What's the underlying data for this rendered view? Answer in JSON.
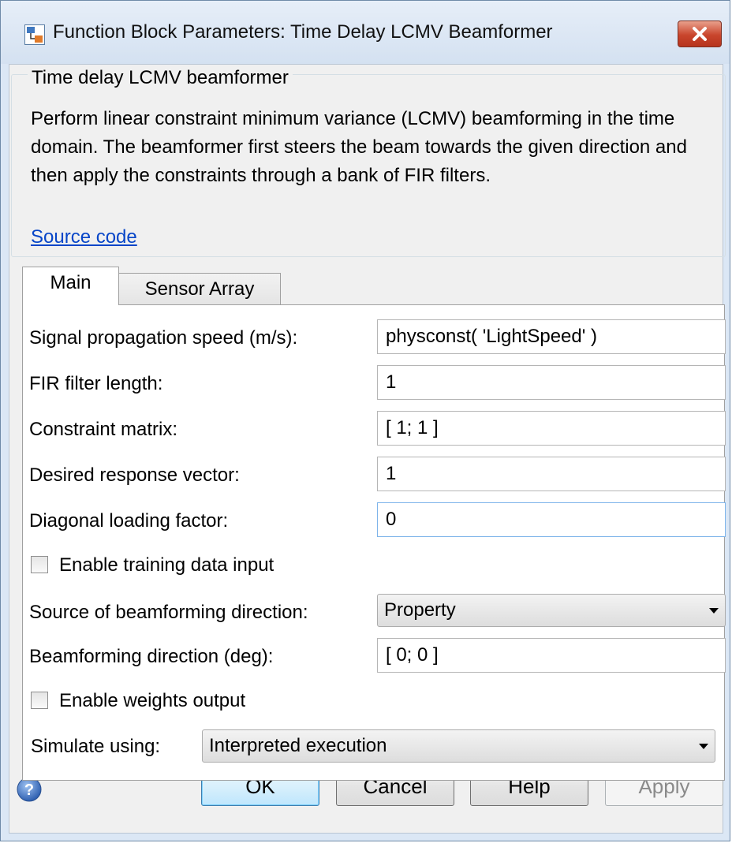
{
  "window": {
    "title": "Function Block Parameters: Time Delay LCMV Beamformer"
  },
  "description": {
    "group_title": "Time delay LCMV beamformer",
    "text": "Perform linear constraint minimum variance (LCMV) beamforming in the time domain. The beamformer first steers the beam towards the given direction and then apply the constraints through a bank of FIR filters.",
    "source_link": "Source code"
  },
  "tabs": [
    {
      "label": "Main",
      "selected": true
    },
    {
      "label": "Sensor Array",
      "selected": false
    }
  ],
  "params": {
    "propagation_speed": {
      "label": "Signal propagation speed (m/s):",
      "value": "physconst( 'LightSpeed' )"
    },
    "fir_length": {
      "label": "FIR filter length:",
      "value": "1"
    },
    "constraint_matrix": {
      "label": "Constraint matrix:",
      "value": "[ 1; 1 ]"
    },
    "desired_response": {
      "label": "Desired response vector:",
      "value": "1"
    },
    "diagonal_loading": {
      "label": "Diagonal loading factor:",
      "value": "0"
    },
    "training_input": {
      "label": "Enable training data input",
      "checked": false
    },
    "direction_source": {
      "label": "Source of beamforming direction:",
      "value": "Property"
    },
    "direction": {
      "label": "Beamforming direction (deg):",
      "value": "[ 0; 0 ]"
    },
    "weights_output": {
      "label": "Enable weights output",
      "checked": false
    },
    "simulate_using": {
      "label": "Simulate using:",
      "value": "Interpreted execution"
    }
  },
  "buttons": {
    "ok": "OK",
    "cancel": "Cancel",
    "help": "Help",
    "apply": "Apply"
  },
  "icons": {
    "app": "simulink-block-icon",
    "close": "close-icon",
    "help": "help-icon"
  },
  "colors": {
    "link": "#0645c8",
    "close_button": "#c9452c",
    "default_button": "#bee6fd",
    "frame": "#dbe7f5"
  }
}
